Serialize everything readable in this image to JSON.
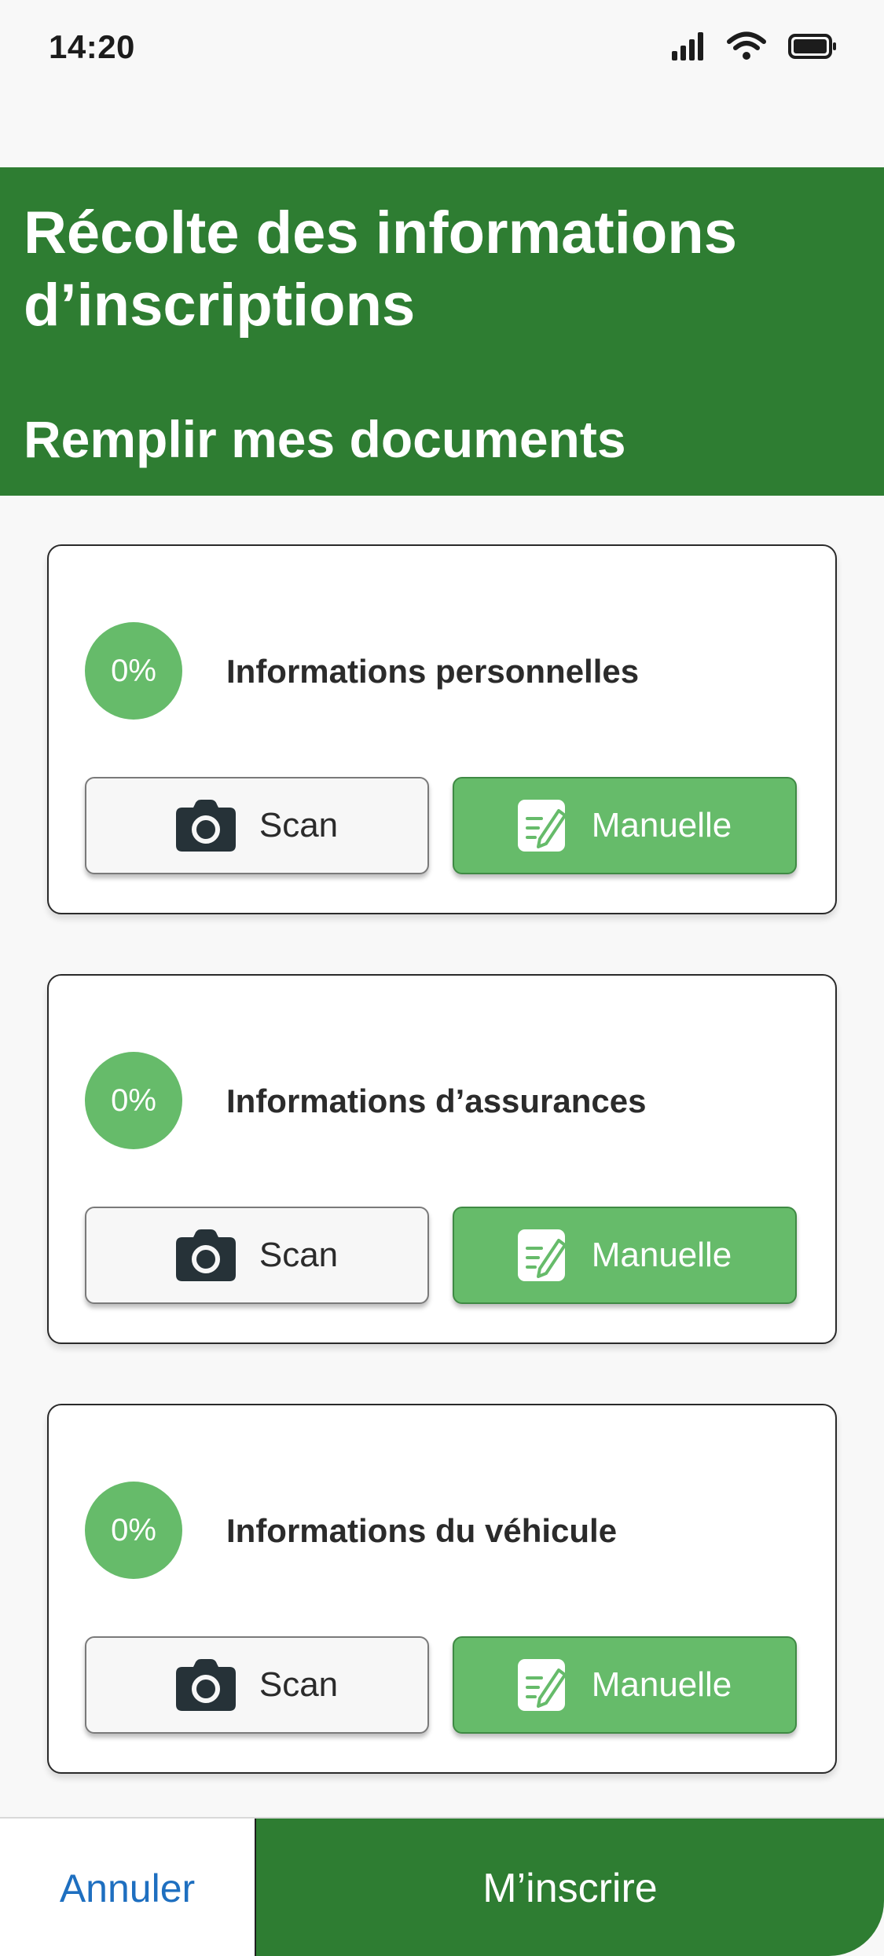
{
  "status_bar": {
    "time": "14:20",
    "icons": [
      "signal-icon",
      "wifi-icon",
      "battery-icon"
    ]
  },
  "header": {
    "title": "Récolte des informations d’inscriptions",
    "subtitle": "Remplir mes documents"
  },
  "cards": [
    {
      "progress": "0%",
      "title": "Informations personnelles",
      "scan_label": "Scan",
      "manual_label": "Manuelle"
    },
    {
      "progress": "0%",
      "title": "Informations d’assurances",
      "scan_label": "Scan",
      "manual_label": "Manuelle"
    },
    {
      "progress": "0%",
      "title": "Informations du véhicule",
      "scan_label": "Scan",
      "manual_label": "Manuelle"
    }
  ],
  "footer": {
    "cancel_label": "Annuler",
    "register_label": "M’inscrire"
  },
  "colors": {
    "header_green": "#2e7d32",
    "button_green": "#66bb6a",
    "link_blue": "#1e6fc0"
  }
}
